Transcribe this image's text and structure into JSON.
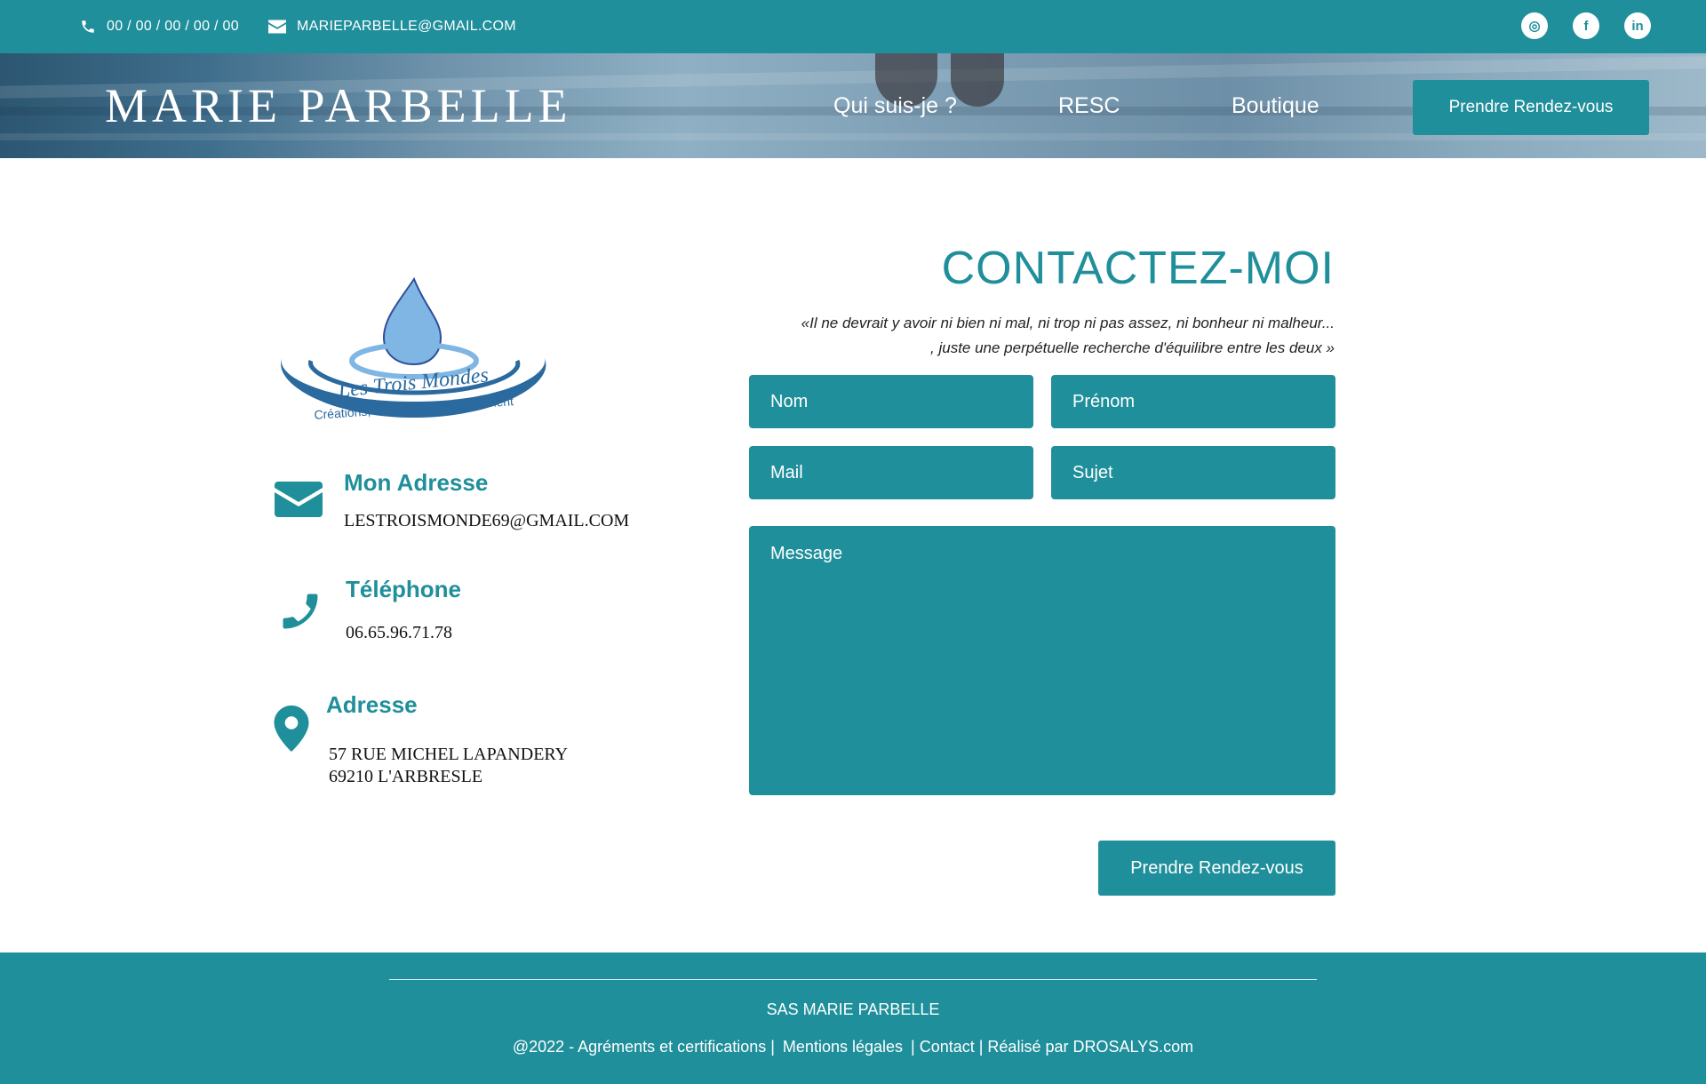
{
  "topbar": {
    "phone": "00 / 00 / 00 / 00 / 00",
    "email": "MARIEPARBELLE@GMAIL.COM",
    "socials": [
      {
        "name": "instagram-icon",
        "glyph": "◎"
      },
      {
        "name": "facebook-icon",
        "glyph": "f"
      },
      {
        "name": "linkedin-icon",
        "glyph": "in"
      }
    ]
  },
  "header": {
    "brand": "MARIE PARBELLE",
    "nav": [
      "Qui suis-je ?",
      "RESC",
      "Boutique"
    ],
    "cta": "Prendre Rendez-vous"
  },
  "logo": {
    "line1": "Les Trois Mondes",
    "line2": "Créations, Soin & Accompagnement"
  },
  "contact_info": {
    "mail_title": "Mon Adresse",
    "mail_value": "LESTROISMONDE69@GMAIL.COM",
    "phone_title": "Téléphone",
    "phone_value": "06.65.96.71.78",
    "address_title": "Adresse",
    "address_line1": "57 RUE MICHEL LAPANDERY",
    "address_line2": "69210 L'ARBRESLE"
  },
  "form": {
    "title": "CONTACTEZ-MOI",
    "quote_line1": "«Il ne devrait y avoir ni bien ni mal, ni trop ni pas assez, ni bonheur ni malheur...",
    "quote_line2": ", juste une perpétuelle recherche d'équilibre entre les deux »",
    "nom": "Nom",
    "prenom": "Prénom",
    "mail": "Mail",
    "sujet": "Sujet",
    "message": "Message",
    "submit": "Prendre Rendez-vous"
  },
  "footer": {
    "company": "SAS MARIE PARBELLE",
    "links": [
      "@2022 - Agréments et certifications |",
      "Mentions légales",
      "| Contact | Réalisé par DROSALYS.com"
    ]
  },
  "colors": {
    "primary": "#1f8f9b",
    "logo_blue": "#2a6a9e",
    "drop_blue": "#7fb6e3"
  }
}
